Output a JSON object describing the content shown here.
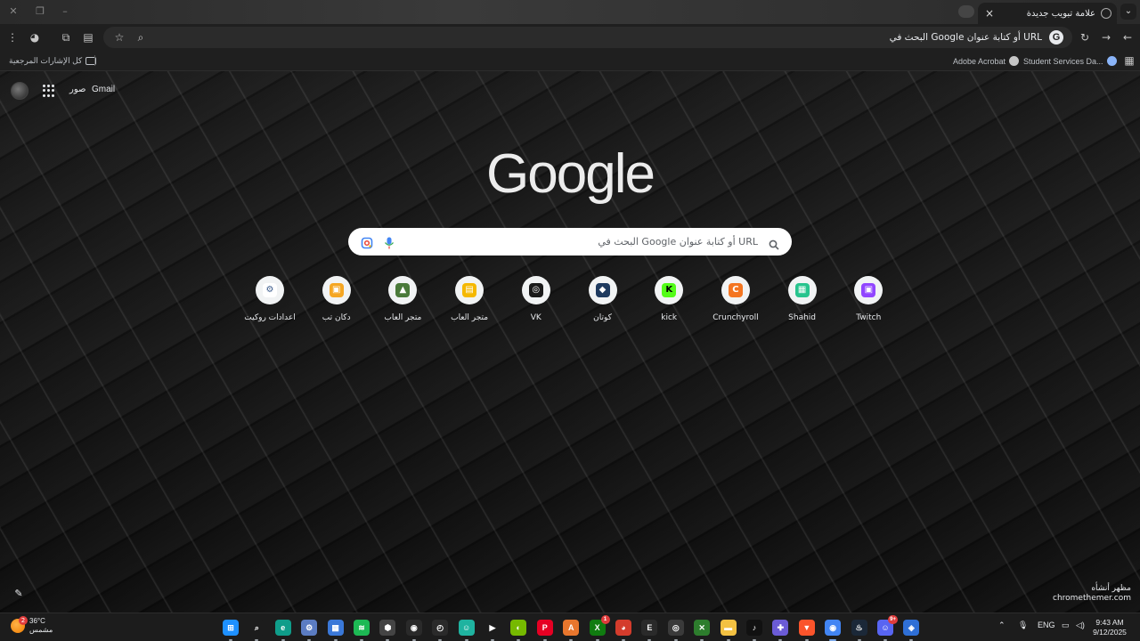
{
  "browser": {
    "tab": {
      "title": "علامة تبويب جديدة",
      "close_glyph": "×"
    },
    "omnibox": {
      "text": "البحث في Google أو كتابة عنوان URL",
      "badge": "G"
    },
    "bookmarks": {
      "all_bookmarks": "كل الإشارات المرجعية",
      "items": [
        {
          "label": "Student Services Da...",
          "icon": "student-services-icon"
        },
        {
          "label": "Adobe Acrobat",
          "icon": "adobe-acrobat-icon"
        }
      ]
    }
  },
  "ntp": {
    "header": {
      "gmail": "Gmail",
      "images": "صور"
    },
    "logo": "Google",
    "search": {
      "placeholder": "البحث في Google أو كتابة عنوان URL"
    },
    "shortcuts": [
      {
        "label": "اعدادات روكيت",
        "icon": "rocket-settings-icon",
        "color": "#ffffff",
        "glyph": "⚙"
      },
      {
        "label": "دكان تب",
        "icon": "shop-tab-icon",
        "color": "#f5a623",
        "glyph": "▣"
      },
      {
        "label": "متجر العاب",
        "icon": "game-store-icon",
        "color": "#4a7a3a",
        "glyph": "▲"
      },
      {
        "label": "متجر العاب",
        "icon": "game-store-2-icon",
        "color": "#f5b800",
        "glyph": "▤"
      },
      {
        "label": "VK",
        "icon": "vk-icon",
        "color": "#1a1a1a",
        "glyph": "◎"
      },
      {
        "label": "كوتان",
        "icon": "kotan-icon",
        "color": "#1e3a5f",
        "glyph": "◆"
      },
      {
        "label": "kick",
        "icon": "kick-icon",
        "color": "#53fc18",
        "glyph": "K"
      },
      {
        "label": "Crunchyroll",
        "icon": "crunchyroll-icon",
        "color": "#f47521",
        "glyph": "C"
      },
      {
        "label": "Shahid",
        "icon": "shahid-icon",
        "color": "#27c48e",
        "glyph": "▦"
      },
      {
        "label": "Twitch",
        "icon": "twitch-icon",
        "color": "#9146ff",
        "glyph": "▣"
      }
    ],
    "theme_credit": {
      "line1": "مظهر أنشأه",
      "line2": "chromethemer.com"
    }
  },
  "taskbar": {
    "weather": {
      "temp": "36°C",
      "condition": "مشمس",
      "badge": "2"
    },
    "apps": [
      {
        "name": "windows-start-icon",
        "color": "#1e90ff",
        "glyph": "⊞"
      },
      {
        "name": "search-icon",
        "color": "#1c1c1c",
        "glyph": "⌕"
      },
      {
        "name": "edge-icon",
        "color": "#0f9d8a",
        "glyph": "e"
      },
      {
        "name": "settings-icon",
        "color": "#5b7cc2",
        "glyph": "⚙"
      },
      {
        "name": "store-icon",
        "color": "#3a78d8",
        "glyph": "▦"
      },
      {
        "name": "spotify-icon",
        "color": "#1db954",
        "glyph": "≋"
      },
      {
        "name": "app-hex-icon",
        "color": "#444444",
        "glyph": "⬢"
      },
      {
        "name": "app-circle-icon",
        "color": "#2a2a2a",
        "glyph": "◉"
      },
      {
        "name": "app-clock-icon",
        "color": "#2a2a2a",
        "glyph": "◴"
      },
      {
        "name": "app-bot-icon",
        "color": "#1fb3a0",
        "glyph": "☺"
      },
      {
        "name": "play-icon",
        "color": "#1c1c1c",
        "glyph": "▶"
      },
      {
        "name": "nvidia-icon",
        "color": "#76b900",
        "glyph": "◐"
      },
      {
        "name": "pinterest-icon",
        "color": "#e60023",
        "glyph": "P"
      },
      {
        "name": "app-a-icon",
        "color": "#e8762d",
        "glyph": "A"
      },
      {
        "name": "xbox-icon",
        "color": "#107c10",
        "glyph": "X",
        "badge": "1"
      },
      {
        "name": "app-red-icon",
        "color": "#d43c2c",
        "glyph": "◕"
      },
      {
        "name": "epic-games-icon",
        "color": "#2a2a2a",
        "glyph": "E"
      },
      {
        "name": "app-ring-icon",
        "color": "#3a3a3a",
        "glyph": "◎"
      },
      {
        "name": "xbox-app-icon",
        "color": "#2d7d2d",
        "glyph": "✕"
      },
      {
        "name": "file-explorer-icon",
        "color": "#f3c142",
        "glyph": "▬"
      },
      {
        "name": "tiktok-icon",
        "color": "#111111",
        "glyph": "♪"
      },
      {
        "name": "gamepad-icon",
        "color": "#6b5bd6",
        "glyph": "✚"
      },
      {
        "name": "brave-icon",
        "color": "#fb542b",
        "glyph": "▼"
      },
      {
        "name": "chrome-icon",
        "color": "#4285f4",
        "glyph": "◉",
        "active": true
      },
      {
        "name": "steam-icon",
        "color": "#1b2838",
        "glyph": "♨"
      },
      {
        "name": "discord-icon",
        "color": "#5865f2",
        "glyph": "☺",
        "badge": "9+"
      },
      {
        "name": "app-blue-icon",
        "color": "#2f6fd6",
        "glyph": "◈"
      }
    ],
    "tray": {
      "lang": "ENG"
    },
    "clock": {
      "time": "9:43 AM",
      "date": "9/12/2025"
    }
  }
}
